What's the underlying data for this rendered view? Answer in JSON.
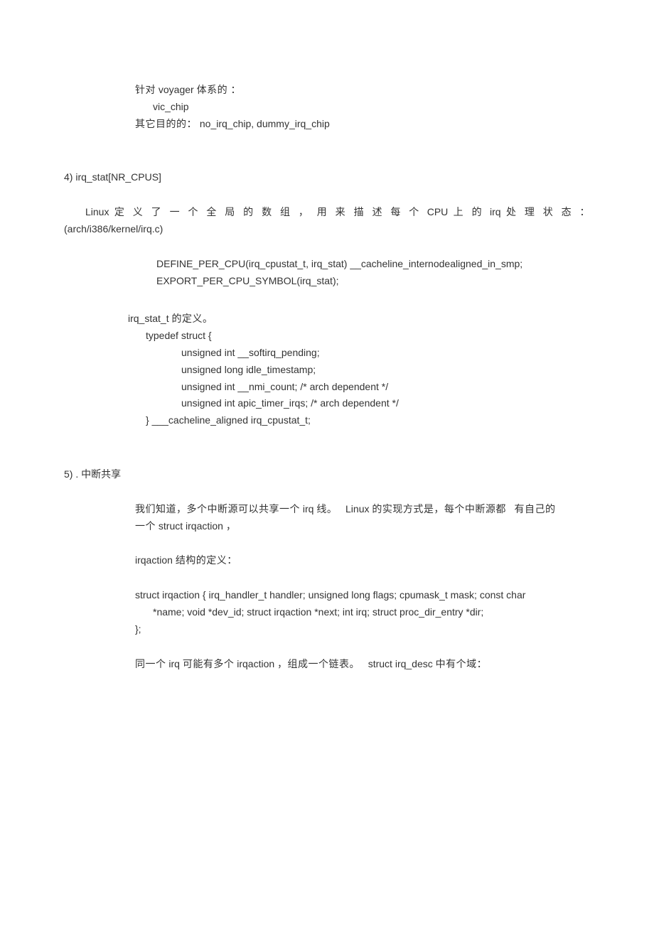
{
  "intro": {
    "line1a": "针对",
    "line1b": "voyager",
    "line1c": "体系的 ：",
    "line2": "vic_chip",
    "line3a": "其它目的的：",
    "line3b": "no_irq_chip, dummy_irq_chip"
  },
  "section4": {
    "heading": "4)  irq_stat[NR_CPUS]",
    "para1_pre": "Linux",
    "para1_mid": "定 义 了 一 个 全 局 的 数 组 ， 用 来 描 述 每 个",
    "para1_cpu": "CPU",
    "para1_mid2": "上 的",
    "para1_irq": "irq",
    "para1_end": "处 理 状 态 ：",
    "para1_line2": "(arch/i386/kernel/irq.c)",
    "code1_l1": "DEFINE_PER_CPU(irq_cpustat_t, irq_stat) __cacheline_internodealigned_in_smp;",
    "code1_l2": "EXPORT_PER_CPU_SYMBOL(irq_stat);",
    "struct_intro_a": "irq_stat_t",
    "struct_intro_b": "的定义。",
    "struct_open": "typedef struct {",
    "struct_f1": "unsigned int __softirq_pending;",
    "struct_f2": "unsigned long idle_timestamp;",
    "struct_f3": "unsigned int __nmi_count; /* arch dependent */",
    "struct_f4": "unsigned int apic_timer_irqs; /* arch dependent */",
    "struct_close": "} ___cacheline_aligned irq_cpustat_t;"
  },
  "section5": {
    "heading": "5)    . 中断共享",
    "p1_a": "我们知道，多个中断源可以共享一个",
    "p1_b": "irq",
    "p1_c": "线。",
    "p1_d": "Linux",
    "p1_e": "的实现方式是，每个中断源都",
    "p1_f": "有自己的",
    "p1_g": "一个",
    "p1_h": "struct irqaction",
    "p1_i": "，",
    "p2_a": "irqaction",
    "p2_b": "结构的定义：",
    "struct_l1": "struct irqaction { irq_handler_t handler; unsigned long flags; cpumask_t mask; const char",
    "struct_l2": "*name; void *dev_id; struct irqaction *next; int irq; struct proc_dir_entry *dir;",
    "struct_l3": "};",
    "p3_a": "同一个",
    "p3_b": "irq",
    "p3_c": "可能有多个",
    "p3_d": "irqaction",
    "p3_e": "，组成一个链表。",
    "p3_f": "struct irq_desc",
    "p3_g": "中有个域："
  }
}
